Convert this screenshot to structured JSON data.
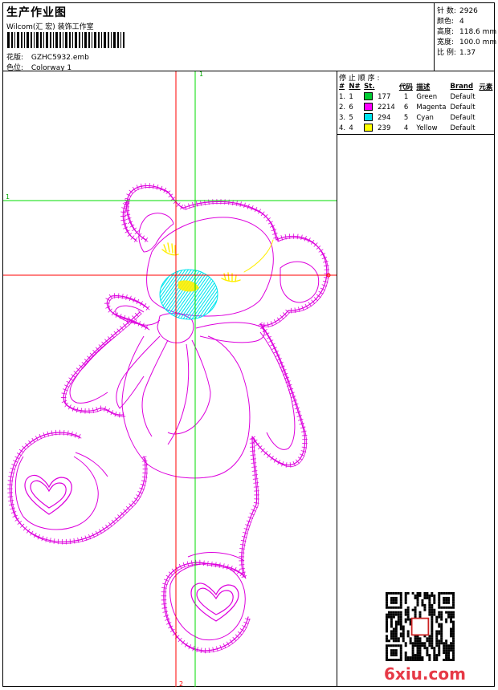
{
  "header": {
    "title": "生产作业图",
    "company": "Wilcom(汇 宏) 装饰工作室",
    "design_label": "花版:",
    "design_value": "GZHC5932.emb",
    "colorway_label": "色位:",
    "colorway_value": "Colorway 1"
  },
  "stats": [
    {
      "label": "针 数:",
      "value": "2926"
    },
    {
      "label": "颜色:",
      "value": "4"
    },
    {
      "label": "高度:",
      "value": "118.6 mm"
    },
    {
      "label": "宽度:",
      "value": "100.0 mm"
    },
    {
      "label": "比 例:",
      "value": "1.37"
    }
  ],
  "stop_sequence": {
    "title": "停 止 顺 序 :",
    "headers": [
      "#",
      "N#",
      "St.",
      "代码",
      "描述",
      "Brand",
      "元素"
    ],
    "rows": [
      {
        "num": "1.",
        "n": "1",
        "color": "#00cc33",
        "st": "177",
        "code": "1",
        "desc": "Green",
        "brand": "Default"
      },
      {
        "num": "2.",
        "n": "6",
        "color": "#ff00ff",
        "st": "2214",
        "code": "6",
        "desc": "Magenta",
        "brand": "Default"
      },
      {
        "num": "3.",
        "n": "5",
        "color": "#00e5ee",
        "st": "294",
        "code": "5",
        "desc": "Cyan",
        "brand": "Default"
      },
      {
        "num": "4.",
        "n": "4",
        "color": "#ffff00",
        "st": "239",
        "code": "4",
        "desc": "Yellow",
        "brand": "Default"
      }
    ]
  },
  "guides": {
    "vertical_top_label": "1",
    "vertical_bottom_label": "2",
    "horizontal_left_label": "1"
  },
  "watermark": "6xiu.com",
  "colors": {
    "stitch": "#dd00dd",
    "guide_red": "#ff0000",
    "guide_green": "#00dd00",
    "fill_cyan": "#00e5ee",
    "fill_yellow": "#ffee00"
  }
}
